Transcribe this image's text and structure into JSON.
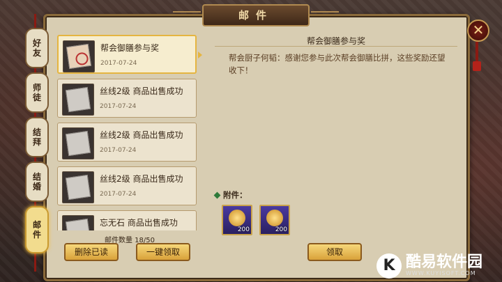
{
  "window": {
    "title": "邮件",
    "close_glyph": "✕"
  },
  "tabs": [
    {
      "label": "好友",
      "active": false
    },
    {
      "label": "师徒",
      "active": false
    },
    {
      "label": "结拜",
      "active": false
    },
    {
      "label": "结婚",
      "active": false
    },
    {
      "label": "邮件",
      "active": true
    }
  ],
  "mails": [
    {
      "subject": "帮会御膳参与奖",
      "date": "2017-07-24",
      "selected": true
    },
    {
      "subject": "丝线2级 商品出售成功",
      "date": "2017-07-24",
      "selected": false
    },
    {
      "subject": "丝线2级 商品出售成功",
      "date": "2017-07-24",
      "selected": false
    },
    {
      "subject": "丝线2级 商品出售成功",
      "date": "2017-07-24",
      "selected": false
    },
    {
      "subject": "忘无石 商品出售成功",
      "date": "",
      "selected": false
    }
  ],
  "mail_count": "邮件数量 18/50",
  "detail": {
    "title": "帮会御膳参与奖",
    "body": "帮会厨子何韬：感谢您参与此次帮会御膳比拼，这些奖励还望收下！",
    "attachment_label": "附件：",
    "attachments": [
      {
        "icon": "gold-scroll-icon",
        "qty": "200"
      },
      {
        "icon": "gold-ingot-icon",
        "qty": "200"
      }
    ]
  },
  "buttons": {
    "delete_read": "删除已读",
    "claim_all": "一键领取",
    "claim": "领取"
  },
  "watermark": {
    "logo": "K",
    "name": "酷易软件园",
    "url": "WWW.KUYISOFT.COM"
  }
}
